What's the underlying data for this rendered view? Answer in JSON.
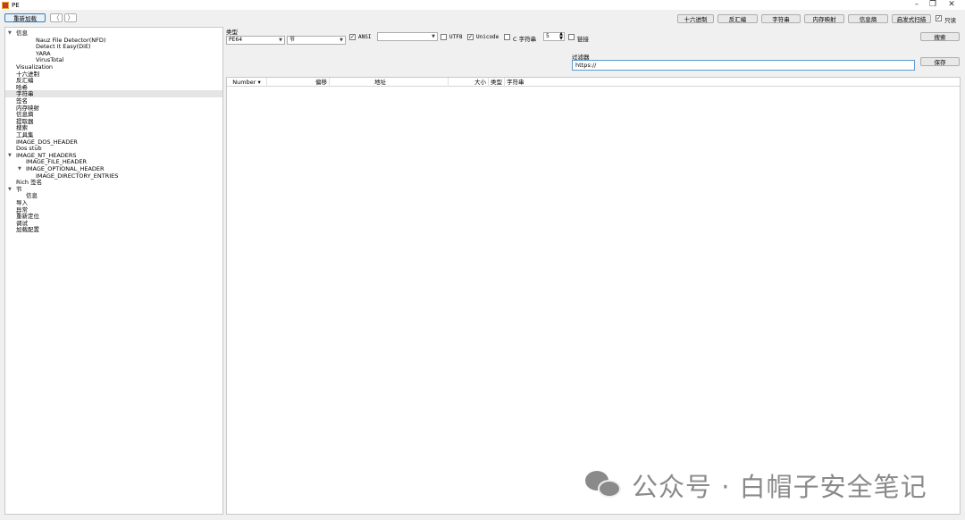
{
  "window": {
    "title": "PE"
  },
  "toolbar": {
    "reload_label": "重新加载",
    "back_label": "〈",
    "forward_label": "〉",
    "hex_label": "十六进制",
    "disasm_label": "反汇编",
    "strings_label": "字符串",
    "memmap_label": "内存映射",
    "entropy_label": "信息熵",
    "heuristic_label": "启发式扫描",
    "readonly_label": "只读",
    "readonly_checked": true
  },
  "tree": {
    "items": [
      {
        "label": "信息",
        "expanded": true
      },
      {
        "label": "Nauz File Detector(NFD)"
      },
      {
        "label": "Detect It Easy(DiE)"
      },
      {
        "label": "YARA"
      },
      {
        "label": "VirusTotal"
      },
      {
        "label": "Visualization"
      },
      {
        "label": "十六进制"
      },
      {
        "label": "反汇编"
      },
      {
        "label": "哈希"
      },
      {
        "label": "字符串",
        "selected": true
      },
      {
        "label": "签名"
      },
      {
        "label": "内存映射"
      },
      {
        "label": "信息熵"
      },
      {
        "label": "提取器"
      },
      {
        "label": "搜索"
      },
      {
        "label": "工具集"
      },
      {
        "label": "IMAGE_DOS_HEADER"
      },
      {
        "label": "Dos stub"
      },
      {
        "label": "IMAGE_NT_HEADERS",
        "expanded": true
      },
      {
        "label": "IMAGE_FILE_HEADER"
      },
      {
        "label": "IMAGE_OPTIONAL_HEADER",
        "expanded": true
      },
      {
        "label": "IMAGE_DIRECTORY_ENTRIES"
      },
      {
        "label": "Rich 签名"
      },
      {
        "label": "节",
        "expanded": true
      },
      {
        "label": "信息"
      },
      {
        "label": "导入"
      },
      {
        "label": "异常"
      },
      {
        "label": "重新定位"
      },
      {
        "label": "调试"
      },
      {
        "label": "加载配置"
      }
    ]
  },
  "strings_panel": {
    "type_label": "类型",
    "type_value": "PE64",
    "section_value": "节",
    "ansi_label": "ANSI",
    "ansi_checked": true,
    "encoding_value": "",
    "utf8_label": "UTF8",
    "utf8_checked": false,
    "unicode_label": "Unicode",
    "unicode_checked": true,
    "c_string_label": "C 字符串",
    "c_string_checked": false,
    "min_length": "5",
    "links_label": "链接",
    "links_checked": false,
    "search_label": "搜索",
    "filter_label": "过滤器",
    "filter_value": "https://",
    "save_label": "保存",
    "columns": [
      "Number",
      "偏移",
      "地址",
      "大小",
      "类型",
      "字符串"
    ],
    "sort_indicator": "▾"
  },
  "watermark": {
    "text": "公众号 · 白帽子安全笔记"
  }
}
